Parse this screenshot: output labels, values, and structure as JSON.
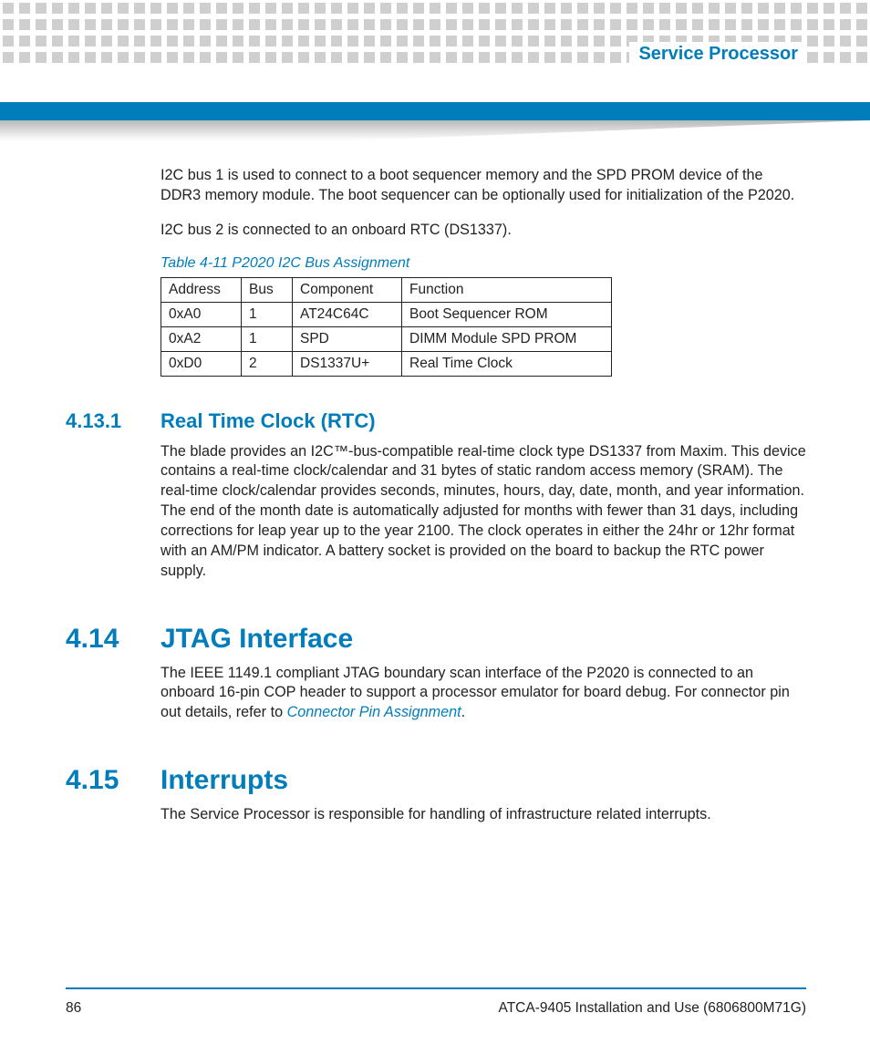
{
  "header": {
    "chapter_label": "Service Processor"
  },
  "intro": {
    "p1": "I2C bus 1 is used to connect to a boot sequencer memory and the SPD PROM device of the DDR3 memory module. The boot sequencer can be optionally used for initialization of the P2020.",
    "p2": "I2C bus 2 is connected to an onboard RTC (DS1337)."
  },
  "table": {
    "caption": "Table 4-11 P2020 I2C Bus Assignment",
    "headers": {
      "c1": "Address",
      "c2": "Bus",
      "c3": "Component",
      "c4": "Function"
    },
    "rows": [
      {
        "c1": "0xA0",
        "c2": "1",
        "c3": "AT24C64C",
        "c4": "Boot Sequencer ROM"
      },
      {
        "c1": "0xA2",
        "c2": "1",
        "c3": "SPD",
        "c4": "DIMM Module SPD PROM"
      },
      {
        "c1": "0xD0",
        "c2": "2",
        "c3": "DS1337U+",
        "c4": "Real Time Clock"
      }
    ]
  },
  "sec_rtc": {
    "num": "4.13.1",
    "title": "Real Time Clock (RTC)",
    "body": "The blade provides an I2C™-bus-compatible real-time clock type DS1337 from Maxim. This device contains a real-time clock/calendar and 31 bytes of static random access memory (SRAM). The real-time clock/calendar provides seconds, minutes, hours, day, date, month, and year information. The end of the month date is automatically adjusted for months with fewer than 31 days, including corrections for leap year up to the year 2100. The clock operates in either the 24hr or 12hr format with an AM/PM indicator. A battery socket is provided on the board to backup the RTC power supply."
  },
  "sec_jtag": {
    "num": "4.14",
    "title": "JTAG Interface",
    "body_before_link": "The IEEE 1149.1 compliant JTAG boundary scan interface of the P2020 is connected to an onboard 16-pin COP header to support a processor emulator for board debug. For connector pin out details, refer to ",
    "link_text": "Connector Pin Assignment",
    "body_after_link": "."
  },
  "sec_int": {
    "num": "4.15",
    "title": "Interrupts",
    "body": "The Service Processor is responsible for handling of infrastructure related interrupts."
  },
  "footer": {
    "page_number": "86",
    "doc_title": "ATCA-9405 Installation and Use (6806800M71G)"
  }
}
